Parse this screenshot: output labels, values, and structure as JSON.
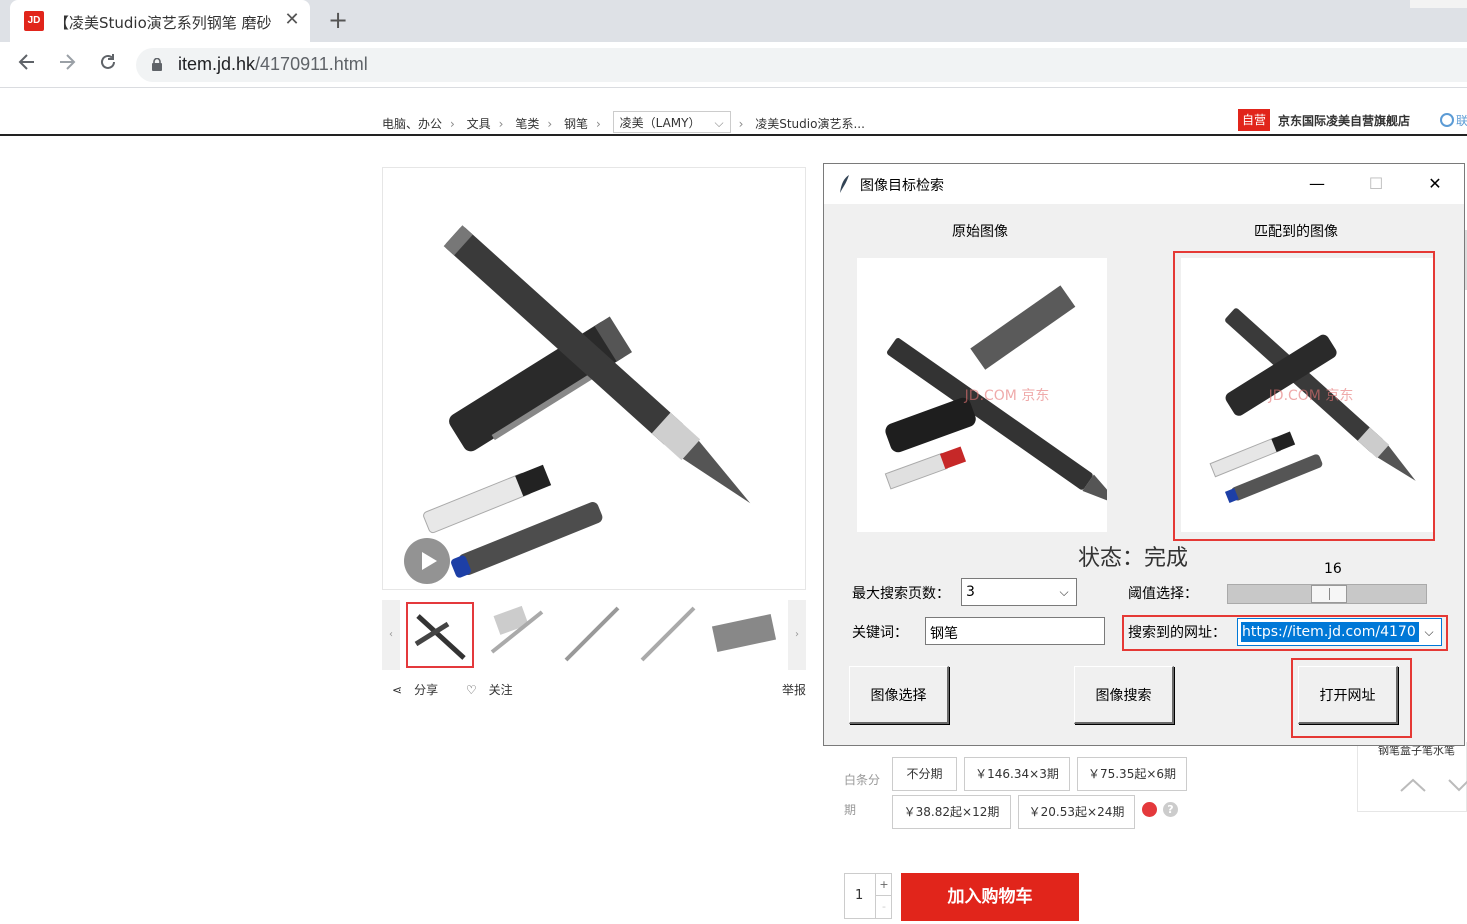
{
  "browser": {
    "tab_title": "【凌美Studio演艺系列钢笔 磨砂",
    "tab_favicon": "JD",
    "close_glyph": "✕",
    "new_tab_glyph": "+",
    "url_host": "item.jd.hk",
    "url_path": "/4170911.html"
  },
  "breadcrumb": {
    "items": [
      "电脑、办公",
      "文具",
      "笔类",
      "钢笔"
    ],
    "brand": "凌美（LAMY）",
    "product": "凌美Studio演艺系..."
  },
  "shop": {
    "badge": "自营",
    "name": "京东国际凌美自营旗舰店",
    "contact": "联"
  },
  "gallery": {
    "share": "分享",
    "follow": "关注",
    "report": "举报"
  },
  "purchase": {
    "installment_label": "白条分期",
    "options": [
      "不分期",
      "￥146.34×3期",
      "￥75.35起×6期",
      "￥38.82起×12期",
      "￥20.53起×24期"
    ],
    "quantity": "1",
    "add_to_cart": "加入购物车",
    "side_text": "钢笔盒子笔水笔"
  },
  "app": {
    "title": "图像目标检索",
    "label_original": "原始图像",
    "label_matched": "匹配到的图像",
    "status": "状态：完成",
    "max_pages_label": "最大搜索页数：",
    "max_pages_value": "3",
    "threshold_label": "阈值选择：",
    "threshold_value": "16",
    "threshold_fraction": 0.16,
    "keyword_label": "关键词：",
    "keyword_value": "钢笔",
    "url_label": "搜索到的网址：",
    "url_value": "https://item.jd.com/4170",
    "buttons": {
      "select": "图像选择",
      "search": "图像搜索",
      "open": "打开网址"
    },
    "watermark": "JD.COM 京东"
  },
  "colors": {
    "jd_red": "#e1251b",
    "highlight_red": "#e53935",
    "selection_blue": "#0078d7"
  }
}
